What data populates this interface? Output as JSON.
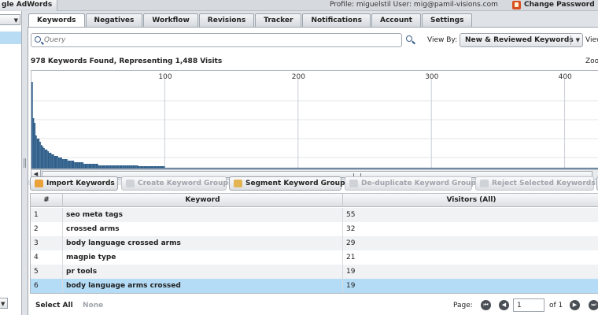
{
  "topbar": {
    "left_title": "gle AdWords",
    "profile_text": "Profile: miguelstil User: mig@pamil-visions.com",
    "change_password": "Change Password"
  },
  "tabs": [
    {
      "label": "Keywords",
      "active": true
    },
    {
      "label": "Negatives"
    },
    {
      "label": "Workflow"
    },
    {
      "label": "Revisions"
    },
    {
      "label": "Tracker"
    },
    {
      "label": "Notifications"
    },
    {
      "label": "Account"
    },
    {
      "label": "Settings"
    }
  ],
  "search": {
    "placeholder": "Query"
  },
  "view_by": {
    "label": "View By:",
    "value": "New & Reviewed Keywords",
    "label2": "View"
  },
  "summary": "978 Keywords Found, Representing 1,488 Visits",
  "zoom_label": "Zoo",
  "chart_data": {
    "type": "bar",
    "x_ticks": [
      100,
      200,
      300,
      400
    ],
    "xlim": [
      0,
      450
    ],
    "bar_color": "#2f5f8a",
    "values": [
      55,
      32,
      29,
      21,
      19,
      19,
      17,
      15,
      14,
      13,
      12,
      12,
      11,
      10,
      10,
      9,
      9,
      8,
      8,
      8,
      7,
      7,
      7,
      6,
      6,
      6,
      6,
      5,
      5,
      5,
      5,
      5,
      4,
      4,
      4,
      4,
      4,
      4,
      4,
      3,
      3,
      3,
      3,
      3,
      3,
      3,
      3,
      3,
      3,
      3,
      2,
      2,
      2,
      2,
      2,
      2,
      2,
      2,
      2,
      2,
      2,
      2,
      2,
      2,
      2,
      2,
      2,
      2,
      2,
      2,
      2,
      2,
      2,
      2,
      2,
      2,
      2,
      2,
      2,
      2,
      1.5,
      1.5,
      1.5,
      1.5,
      1.5,
      1.5,
      1.5,
      1.5,
      1.5,
      1.5,
      1.5,
      1.5,
      1.5,
      1.5,
      1.5,
      1.5,
      1.5,
      1.5,
      1.5,
      1.5
    ]
  },
  "toolbar": {
    "import": "Import Keywords",
    "create_group": "Create Keyword Group",
    "segment_group": "Segment Keyword Group",
    "dedupe_group": "De-duplicate Keyword Group",
    "reject": "Reject Selected Keywords"
  },
  "table": {
    "columns": [
      "#",
      "Keyword",
      "Visitors (All)"
    ],
    "rows": [
      {
        "n": "1",
        "keyword": "seo meta tags",
        "visitors": "55"
      },
      {
        "n": "2",
        "keyword": "crossed arms",
        "visitors": "32"
      },
      {
        "n": "3",
        "keyword": "body language crossed arms",
        "visitors": "29"
      },
      {
        "n": "4",
        "keyword": "magpie type",
        "visitors": "21"
      },
      {
        "n": "5",
        "keyword": "pr tools",
        "visitors": "19"
      },
      {
        "n": "6",
        "keyword": "body language arms crossed",
        "visitors": "19",
        "selected": true
      }
    ]
  },
  "footer": {
    "select_all": "Select All",
    "none": "None",
    "page_label": "Page:",
    "page_value": "1",
    "of_total": "of 1"
  },
  "colors": {
    "accent_blue": "#2f5f8a",
    "selection": "#b5dcf6",
    "change_password_icon": "#d94f1e"
  }
}
